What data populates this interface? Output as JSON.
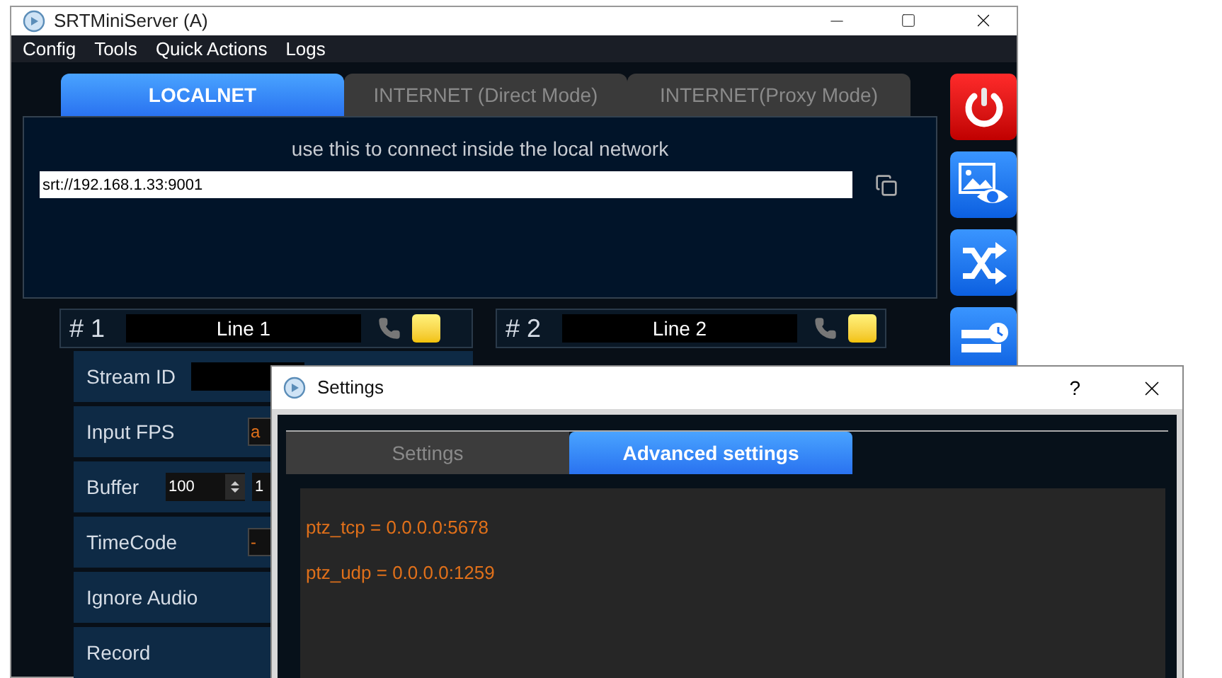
{
  "main_window": {
    "title": "SRTMiniServer (A)"
  },
  "menu": [
    "Config",
    "Tools",
    "Quick Actions",
    "Logs"
  ],
  "tabs": [
    {
      "label": "LOCALNET",
      "selected": true
    },
    {
      "label": "INTERNET (Direct Mode)",
      "selected": false
    },
    {
      "label": "INTERNET(Proxy Mode)",
      "selected": false
    }
  ],
  "connection_panel": {
    "hint": "use this to connect inside the local network",
    "url": "srt://192.168.1.33:9001"
  },
  "side_buttons": [
    {
      "kind": "power"
    },
    {
      "kind": "preview"
    },
    {
      "kind": "shuffle"
    },
    {
      "kind": "schedule"
    }
  ],
  "lines": [
    {
      "number": "# 1",
      "name": "Line 1",
      "rows": [
        {
          "label": "Stream ID",
          "kind": "text"
        },
        {
          "label": "Input FPS",
          "kind": "select",
          "value": "a"
        },
        {
          "label": "Buffer",
          "kind": "spin",
          "value": "100",
          "value_2": "1"
        },
        {
          "label": "TimeCode",
          "kind": "select",
          "value": "-"
        },
        {
          "label": "Ignore Audio",
          "kind": "plain"
        },
        {
          "label": "Record",
          "kind": "plain"
        }
      ]
    },
    {
      "number": "# 2",
      "name": "Line 2"
    }
  ],
  "settings_dialog": {
    "title": "Settings",
    "help": "?",
    "tabs": [
      {
        "label": "Settings",
        "selected": false
      },
      {
        "label": "Advanced settings",
        "selected": true
      }
    ],
    "config_lines": [
      "ptz_tcp = 0.0.0.0:5678",
      "ptz_udp = 0.0.0.0:1259"
    ]
  }
}
